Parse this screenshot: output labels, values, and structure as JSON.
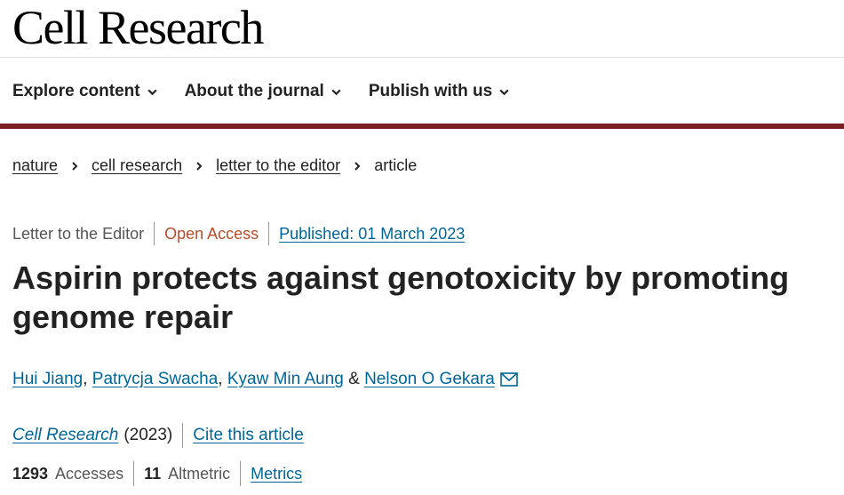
{
  "header": {
    "journal_name": "Cell Research"
  },
  "nav": {
    "items": [
      {
        "label": "Explore content"
      },
      {
        "label": "About the journal"
      },
      {
        "label": "Publish with us"
      }
    ]
  },
  "breadcrumb": {
    "items": [
      "nature",
      "cell research",
      "letter to the editor"
    ],
    "current": "article"
  },
  "article": {
    "type": "Letter to the Editor",
    "access": "Open Access",
    "published": "Published: 01 March 2023",
    "title": "Aspirin protects against genotoxicity by promoting genome repair",
    "authors": [
      "Hui Jiang",
      "Patrycja Swacha",
      "Kyaw Min Aung",
      "Nelson O Gekara"
    ],
    "author_sep1": ", ",
    "author_sep2": ", ",
    "author_amp": " & ",
    "journal": "Cell Research",
    "year": "(2023)",
    "cite_label": "Cite this article",
    "metrics": {
      "accesses_value": "1293",
      "accesses_label": "Accesses",
      "altmetric_value": "11",
      "altmetric_label": "Altmetric",
      "metrics_link": "Metrics"
    }
  },
  "colors": {
    "brand_bar": "#7a1e22",
    "link": "#006699",
    "open_access": "#b84c2b"
  },
  "icons": {
    "nav_chevron": "chevron-down-icon",
    "breadcrumb_sep": "chevron-right-icon",
    "corresponding_author": "mail-icon"
  }
}
